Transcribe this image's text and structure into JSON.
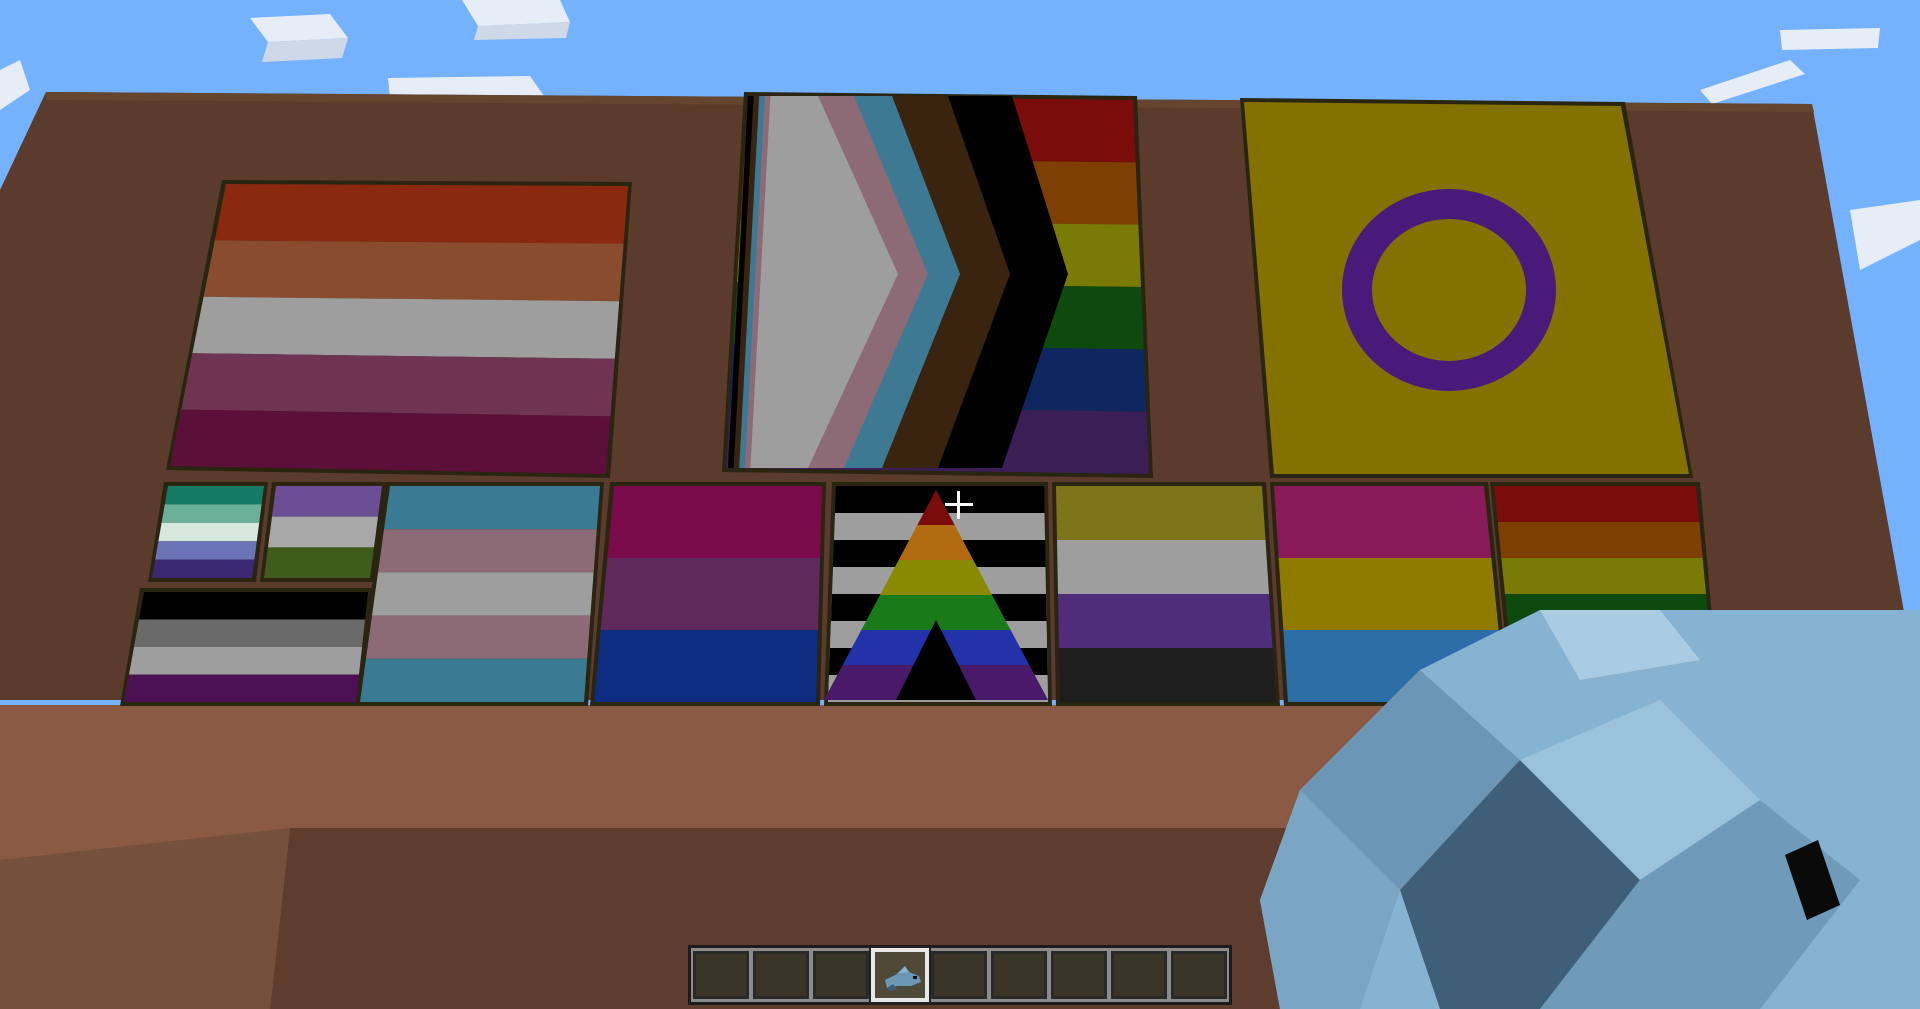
{
  "scene": {
    "description_kind": "minecraft-first-person",
    "colors": {
      "sky": "#74b1ff",
      "cloud": "#e9eff7",
      "wall": "#5a3b2c",
      "floor": "#8a5a44",
      "floor_front": "#5e3d2f",
      "frame": "#2a2510"
    }
  },
  "flags": [
    {
      "id": "lesbian",
      "stripes": [
        "#8a2810",
        "#8a4c2e",
        "#9e9e9e",
        "#6e3452",
        "#5c0f38"
      ]
    },
    {
      "id": "progress",
      "stripes": [
        "#7a0c0c",
        "#7e3f05",
        "#7a7a06",
        "#0e4a0e",
        "#0e2760",
        "#3a1e55"
      ]
    },
    {
      "id": "intersex",
      "field": "#837200",
      "ring": "#4a1a7a"
    },
    {
      "id": "mlm",
      "stripes": [
        "#157a64",
        "#6bb099",
        "#d6e7dd",
        "#6c74b8",
        "#3b2772"
      ]
    },
    {
      "id": "agender",
      "stripes": [
        "#6c4e96",
        "#a8a8a8",
        "#3f5c1c"
      ]
    },
    {
      "id": "asexual",
      "stripes": [
        "#000000",
        "#6a6a6a",
        "#9e9e9e",
        "#4c1054"
      ]
    },
    {
      "id": "trans",
      "stripes": [
        "#3a7b93",
        "#8c6a76",
        "#9e9e9e",
        "#8c6a76",
        "#3a7b93"
      ]
    },
    {
      "id": "bisexual",
      "stripes": [
        "#7a0a4a",
        "#5e2a5c",
        "#0e2d80"
      ]
    },
    {
      "id": "ally",
      "stripes": [
        "#000000",
        "#9e9e9e"
      ]
    },
    {
      "id": "nonbinary",
      "stripes": [
        "#7e741a",
        "#9e9e9e",
        "#4f2d7a",
        "#1e1e1e"
      ]
    },
    {
      "id": "pansexual",
      "stripes": [
        "#8a1a5a",
        "#8e7b00",
        "#2d6ea6"
      ]
    },
    {
      "id": "rainbow",
      "stripes": [
        "#7a0c0c",
        "#7e3f05",
        "#7a7a06",
        "#0e4a0e",
        "#1e2a6a",
        "#4a1a5a"
      ]
    }
  ],
  "held_item": {
    "icon": "dolphin-spawn-egg-icon",
    "colors": {
      "light": "#86b3d2",
      "mid": "#6b96b5",
      "dark": "#3f5f78"
    }
  },
  "hud": {
    "hotbar_slots": 9,
    "selected_slot": 3,
    "selected_item_icon": "dolphin-icon"
  }
}
